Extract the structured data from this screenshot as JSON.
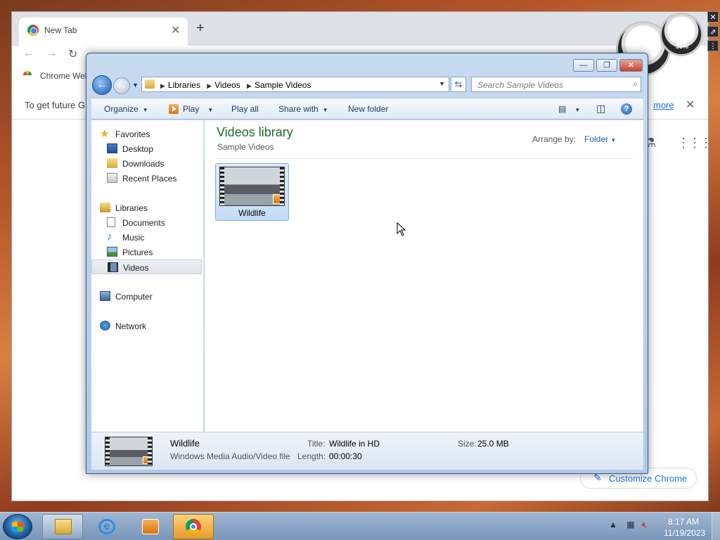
{
  "chrome": {
    "tab_title": "New Tab",
    "tab_close": "✕",
    "new_tab": "+",
    "back": "←",
    "forward": "→",
    "reload": "↻",
    "bookmark_label": "Chrome Web",
    "infobar_message": "To get future G",
    "infobar_link": "more",
    "infobar_close": "✕",
    "customize_label": "Customize Chrome",
    "customize_icon": "pencil-icon",
    "labs_icon": "flask-icon",
    "apps_icon": "apps-grid-icon"
  },
  "gadget": {
    "percent": "36%"
  },
  "explorer": {
    "window_controls": {
      "minimize": "—",
      "maximize": "❐",
      "close": "✕"
    },
    "breadcrumbs": [
      "Libraries",
      "Videos",
      "Sample Videos"
    ],
    "search_placeholder": "Search Sample Videos",
    "commands": {
      "organize": "Organize",
      "play": "Play",
      "play_all": "Play all",
      "share_with": "Share with",
      "new_folder": "New folder",
      "help": "?"
    },
    "nav": {
      "favorites": "Favorites",
      "desktop": "Desktop",
      "downloads": "Downloads",
      "recent_places": "Recent Places",
      "libraries": "Libraries",
      "documents": "Documents",
      "music": "Music",
      "pictures": "Pictures",
      "videos": "Videos",
      "computer": "Computer",
      "network": "Network"
    },
    "library_title": "Videos library",
    "library_subtitle": "Sample Videos",
    "arrange_label": "Arrange by:",
    "arrange_value": "Folder",
    "items": [
      {
        "name": "Wildlife"
      }
    ],
    "details": {
      "name": "Wildlife",
      "type": "Windows Media Audio/Video file",
      "title_label": "Title:",
      "title_value": "Wildlife in HD",
      "length_label": "Length:",
      "length_value": "00:00:30",
      "size_label": "Size:",
      "size_value": "25.0 MB"
    }
  },
  "taskbar": {
    "time": "8:17 AM",
    "date": "11/19/2023",
    "apps": [
      "explorer",
      "internet-explorer",
      "media-player",
      "chrome"
    ]
  }
}
